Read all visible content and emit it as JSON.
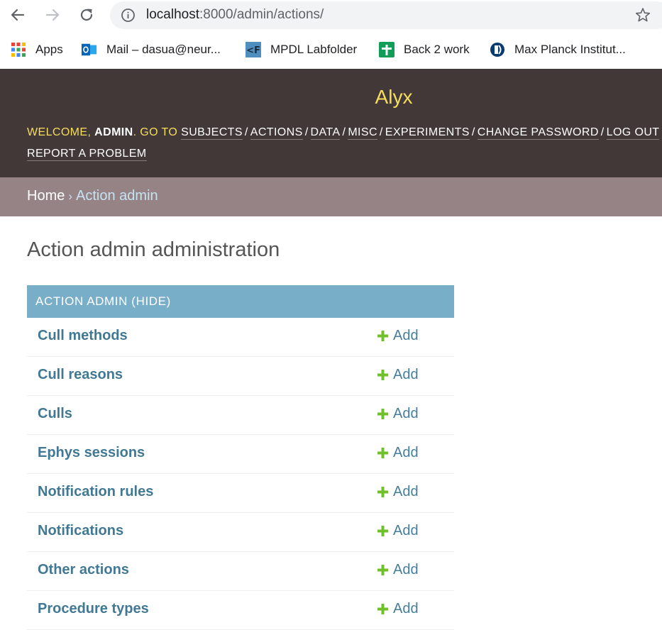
{
  "browser": {
    "url_host": "localhost",
    "url_path": ":8000/admin/actions/",
    "bookmarks": [
      {
        "label": "Apps",
        "icon": "apps-grid-icon"
      },
      {
        "label": "Mail – dasua@neur...",
        "icon": "outlook-mail-icon"
      },
      {
        "label": "MPDL Labfolder",
        "icon": "labfolder-icon"
      },
      {
        "label": "Back 2 work",
        "icon": "sheets-icon"
      },
      {
        "label": "Max Planck Institut...",
        "icon": "max-planck-icon"
      }
    ]
  },
  "header": {
    "brand": "Alyx",
    "welcome": "WELCOME, ",
    "username": "ADMIN",
    "goto": ". GO TO ",
    "links": [
      "SUBJECTS",
      "ACTIONS",
      "DATA",
      "MISC",
      "EXPERIMENTS",
      "CHANGE PASSWORD",
      "LOG OUT"
    ],
    "report": "REPORT A PROBLEM",
    "separator": "/"
  },
  "breadcrumbs": {
    "home": "Home",
    "separator": "›",
    "current": "Action admin"
  },
  "content": {
    "title": "Action admin administration",
    "module_caption": "ACTION ADMIN (HIDE)",
    "add_label": "Add",
    "models": [
      "Cull methods",
      "Cull reasons",
      "Culls",
      "Ephys sessions",
      "Notification rules",
      "Notifications",
      "Other actions",
      "Procedure types"
    ]
  },
  "colors": {
    "header_bg": "#433838",
    "brand": "#f5dd5d",
    "breadcrumb_bg": "#958386",
    "module_caption_bg": "#79aec8",
    "model_link": "#417893",
    "add_icon": "#70bf2b"
  }
}
